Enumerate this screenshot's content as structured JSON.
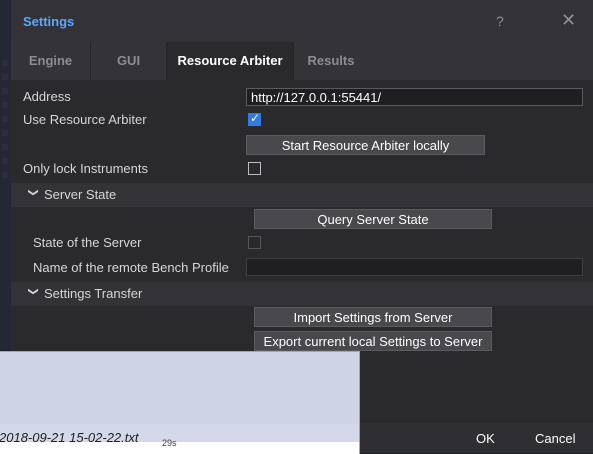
{
  "dialog": {
    "title": "Settings",
    "help_glyph": "?",
    "close_glyph": "✕",
    "tabs": [
      {
        "label": "Engine",
        "active": false
      },
      {
        "label": "GUI",
        "active": false
      },
      {
        "label": "Resource Arbiter",
        "active": true
      },
      {
        "label": "Results",
        "active": false
      }
    ]
  },
  "form": {
    "address_label": "Address",
    "address_value": "http://127.0.0.1:55441/",
    "use_arbiter_label": "Use Resource Arbiter",
    "use_arbiter_checked": true,
    "start_locally_button": "Start Resource Arbiter locally",
    "only_lock_label": "Only lock Instruments",
    "only_lock_checked": false
  },
  "server_state": {
    "section_title": "Server State",
    "query_button": "Query Server State",
    "state_label": "State of the Server",
    "state_checked": false,
    "bench_profile_label": "Name of the remote Bench Profile",
    "bench_profile_value": ""
  },
  "settings_transfer": {
    "section_title": "Settings Transfer",
    "import_button": "Import Settings from Server",
    "export_button": "Export current local Settings to Server"
  },
  "footer": {
    "ok_label": "OK",
    "cancel_label": "Cancel"
  },
  "overlay": {
    "file_text": "2018-09-21 15-02-22.txt",
    "footer_text": "29s"
  },
  "colors": {
    "title_accent": "#5aa9ff",
    "checkbox_checked": "#2e7bea"
  }
}
